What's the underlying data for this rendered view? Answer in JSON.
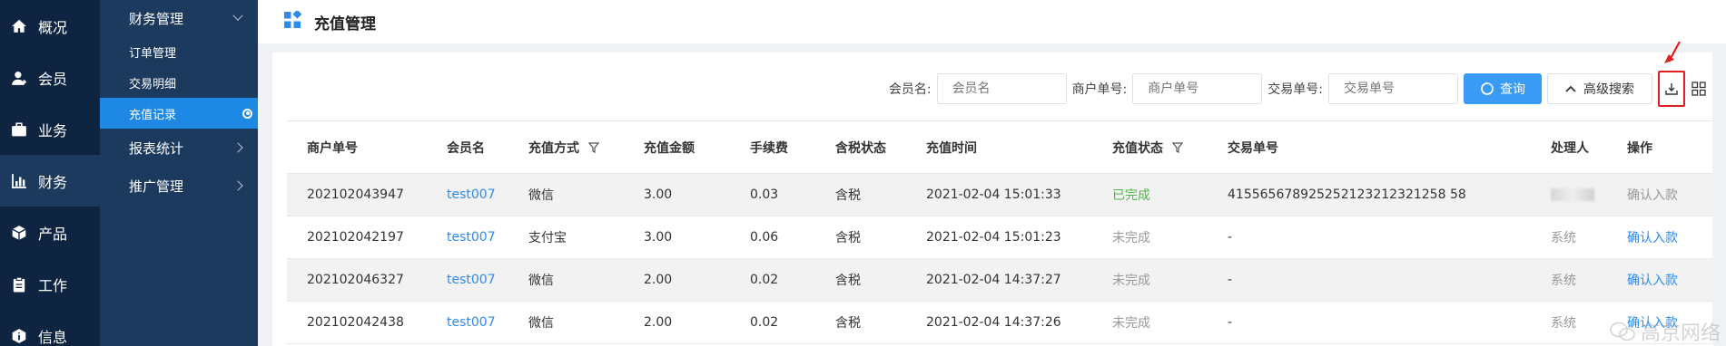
{
  "rail": [
    {
      "label": "概况",
      "icon": "home-icon"
    },
    {
      "label": "会员",
      "icon": "user-icon"
    },
    {
      "label": "业务",
      "icon": "briefcase-icon"
    },
    {
      "label": "财务",
      "icon": "bar-chart-icon",
      "active": true
    },
    {
      "label": "产品",
      "icon": "cube-icon"
    },
    {
      "label": "工作",
      "icon": "clipboard-icon"
    },
    {
      "label": "信息",
      "icon": "info-icon"
    }
  ],
  "submenu": {
    "header": "财务管理",
    "items": [
      "订单管理",
      "交易明细",
      "充值记录"
    ],
    "active_item": "充值记录",
    "groups": [
      "报表统计",
      "推广管理"
    ]
  },
  "page": {
    "title": "充值管理"
  },
  "filters": {
    "member_label": "会员名:",
    "member_placeholder": "会员名",
    "merchant_label": "商户单号:",
    "merchant_placeholder": "商户单号",
    "trade_label": "交易单号:",
    "trade_placeholder": "交易单号",
    "query_label": "查询",
    "advanced_label": "高级搜索"
  },
  "table": {
    "headers": [
      "商户单号",
      "会员名",
      "充值方式",
      "充值金额",
      "手续费",
      "含税状态",
      "充值时间",
      "充值状态",
      "交易单号",
      "处理人",
      "操作"
    ],
    "rows": [
      [
        "202102043947",
        "test007",
        "微信",
        "3.00",
        "0.03",
        "含税",
        "2021-02-04 15:01:33",
        "已完成",
        "415565678925252123212321258 58",
        "",
        "确认入款"
      ],
      [
        "202102042197",
        "test007",
        "支付宝",
        "3.00",
        "0.06",
        "含税",
        "2021-02-04 15:01:23",
        "未完成",
        "-",
        "系统",
        "确认入款"
      ],
      [
        "202102046327",
        "test007",
        "微信",
        "2.00",
        "0.02",
        "含税",
        "2021-02-04 14:37:27",
        "未完成",
        "-",
        "系统",
        "确认入款"
      ],
      [
        "202102042438",
        "test007",
        "微信",
        "2.00",
        "0.02",
        "含税",
        "2021-02-04 14:37:26",
        "未完成",
        "-",
        "系统",
        "确认入款"
      ]
    ]
  },
  "watermark": "高京网络",
  "colors": {
    "rail_bg": "#0f2440",
    "submenu_bg": "#1c3a5e",
    "accent": "#1e88e5",
    "link": "#2d8cf0",
    "done": "#52b64a",
    "highlight": "#e02020"
  }
}
